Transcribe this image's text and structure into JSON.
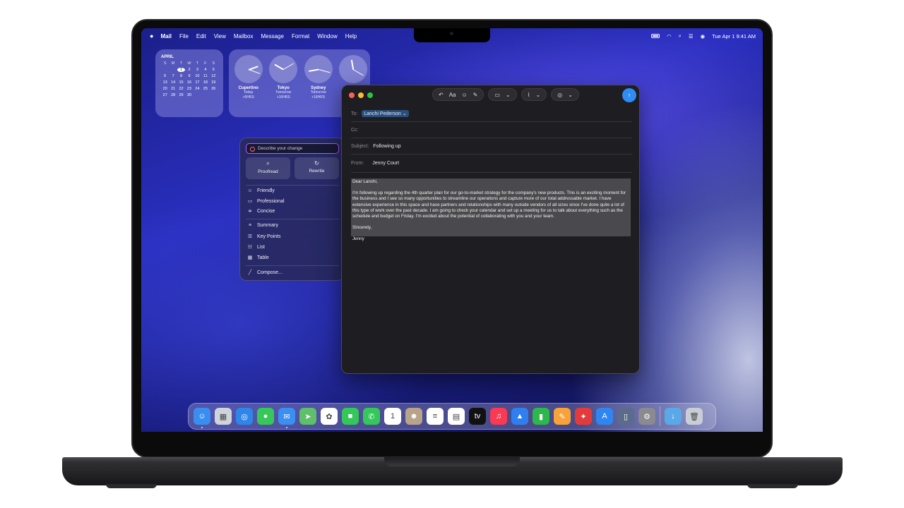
{
  "menubar": {
    "app": "Mail",
    "items": [
      "File",
      "Edit",
      "View",
      "Mailbox",
      "Message",
      "Format",
      "Window",
      "Help"
    ],
    "datetime": "Tue Apr 1  9:41 AM"
  },
  "calendar": {
    "month": "APRIL",
    "weekdays": [
      "S",
      "M",
      "T",
      "W",
      "T",
      "F",
      "S"
    ],
    "weeks": [
      [
        "",
        "",
        "1",
        "2",
        "3",
        "4",
        "5"
      ],
      [
        "6",
        "7",
        "8",
        "9",
        "10",
        "11",
        "12"
      ],
      [
        "13",
        "14",
        "15",
        "16",
        "17",
        "18",
        "19"
      ],
      [
        "20",
        "21",
        "22",
        "23",
        "24",
        "25",
        "26"
      ],
      [
        "27",
        "28",
        "29",
        "30",
        "",
        "",
        ""
      ]
    ],
    "today": "1"
  },
  "world_clocks": [
    {
      "city": "Cupertino",
      "day": "Today",
      "offset": "+0HRS"
    },
    {
      "city": "Tokyo",
      "day": "Tomorrow",
      "offset": "+16HRS"
    },
    {
      "city": "Sydney",
      "day": "Tomorrow",
      "offset": "+18HRS"
    }
  ],
  "writing_tools": {
    "placeholder": "Describe your change",
    "proofread": "Proofread",
    "rewrite": "Rewrite",
    "tones": [
      "Friendly",
      "Professional",
      "Concise"
    ],
    "formats": [
      "Summary",
      "Key Points",
      "List",
      "Table"
    ],
    "compose": "Compose..."
  },
  "compose": {
    "to_label": "To:",
    "to_value": "Lanchi Pederson",
    "cc_label": "Cc:",
    "subject_label": "Subject:",
    "subject_value": "Following up",
    "from_label": "From:",
    "from_value": "Jenny Court",
    "font_button": "Aa",
    "greeting": "Dear Lanchi,",
    "paragraph": "I'm following up regarding the 4th quarter plan for our go-to-market strategy for the company's new products. This is an exciting moment for the business and I see so many opportunities to streamline our operations and capture more of our total addressable market. I have extensive experience in this space and have partners and relationships with many outside vendors of all sizes since I've done quite a lot of this type of work over the past decade. I am going to check your calendar and set up a meeting for us to talk about everything such as the schedule and budget on Friday. I'm excited about the potential of collaborating with you and your team.",
    "closing": "Sincerely,",
    "signature": "Jenny"
  },
  "dock": {
    "apps": [
      {
        "name": "finder",
        "color": "#3a8ef0",
        "glyph": "☺",
        "running": true
      },
      {
        "name": "launchpad",
        "color": "#cfd3dc",
        "glyph": "▦",
        "running": false
      },
      {
        "name": "safari",
        "color": "#2f86e8",
        "glyph": "◎",
        "running": false
      },
      {
        "name": "messages",
        "color": "#38c75a",
        "glyph": "●",
        "running": false
      },
      {
        "name": "mail",
        "color": "#3b8ff0",
        "glyph": "✉",
        "running": true
      },
      {
        "name": "maps",
        "color": "#5fbf6a",
        "glyph": "➤",
        "running": false
      },
      {
        "name": "photos",
        "color": "#ffffff",
        "glyph": "✿",
        "running": false
      },
      {
        "name": "facetime",
        "color": "#34c759",
        "glyph": "■",
        "running": false
      },
      {
        "name": "phone",
        "color": "#34c759",
        "glyph": "✆",
        "running": false
      },
      {
        "name": "calendar",
        "color": "#ffffff",
        "glyph": "1",
        "running": false
      },
      {
        "name": "contacts",
        "color": "#b8a48a",
        "glyph": "☻",
        "running": false
      },
      {
        "name": "reminders",
        "color": "#ffffff",
        "glyph": "≡",
        "running": false
      },
      {
        "name": "notes",
        "color": "#ffffff",
        "glyph": "▤",
        "running": false
      },
      {
        "name": "tv",
        "color": "#111111",
        "glyph": "tv",
        "running": false
      },
      {
        "name": "music",
        "color": "#fa3a55",
        "glyph": "♫",
        "running": false
      },
      {
        "name": "keynote",
        "color": "#2f7ff0",
        "glyph": "▲",
        "running": false
      },
      {
        "name": "numbers",
        "color": "#2db84d",
        "glyph": "▮",
        "running": false
      },
      {
        "name": "pages",
        "color": "#f7a23a",
        "glyph": "✎",
        "running": false
      },
      {
        "name": "rocketsim",
        "color": "#e33b3b",
        "glyph": "✦",
        "running": false
      },
      {
        "name": "app-store",
        "color": "#2f86f0",
        "glyph": "A",
        "running": false
      },
      {
        "name": "iphone-mirroring",
        "color": "#5b6b8c",
        "glyph": "▯",
        "running": false
      },
      {
        "name": "system-settings",
        "color": "#8a8a90",
        "glyph": "⚙",
        "running": false
      }
    ],
    "extras": [
      {
        "name": "downloads",
        "color": "#5aa8e8",
        "glyph": "↓",
        "running": false
      },
      {
        "name": "trash",
        "color": "#c9cdd6",
        "glyph": "🗑",
        "running": false
      }
    ]
  },
  "colors": {
    "accent": "#2f8cf5",
    "traffic_red": "#ff5f57",
    "traffic_yellow": "#febc2e",
    "traffic_green": "#28c840",
    "writing_tools_border": "#b35cff"
  }
}
